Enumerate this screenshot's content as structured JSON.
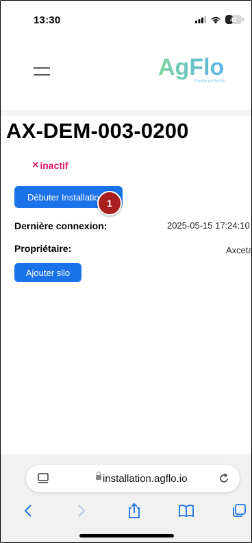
{
  "status_bar": {
    "time": "13:30",
    "battery_level": "47"
  },
  "header": {
    "logo_text": "AgFlo",
    "logo_subtitle": "Propulsé par Axceta"
  },
  "device": {
    "id": "AX-DEM-003-0200",
    "status_symbol": "×",
    "status_text": "inactif",
    "install_button_label": "Débuter Installation",
    "marker_number": "1",
    "last_connection_label": "Dernière connexion:",
    "last_connection_value": "2025-05-15 17:24:10",
    "owner_label": "Propriétaire:",
    "owner_value": "Axceta",
    "add_silo_label": "Ajouter silo"
  },
  "browser": {
    "url": "installation.agflo.io"
  },
  "colors": {
    "accent": "#1a73e8",
    "status_inactive": "#e3166c",
    "marker": "#a91e1e"
  }
}
